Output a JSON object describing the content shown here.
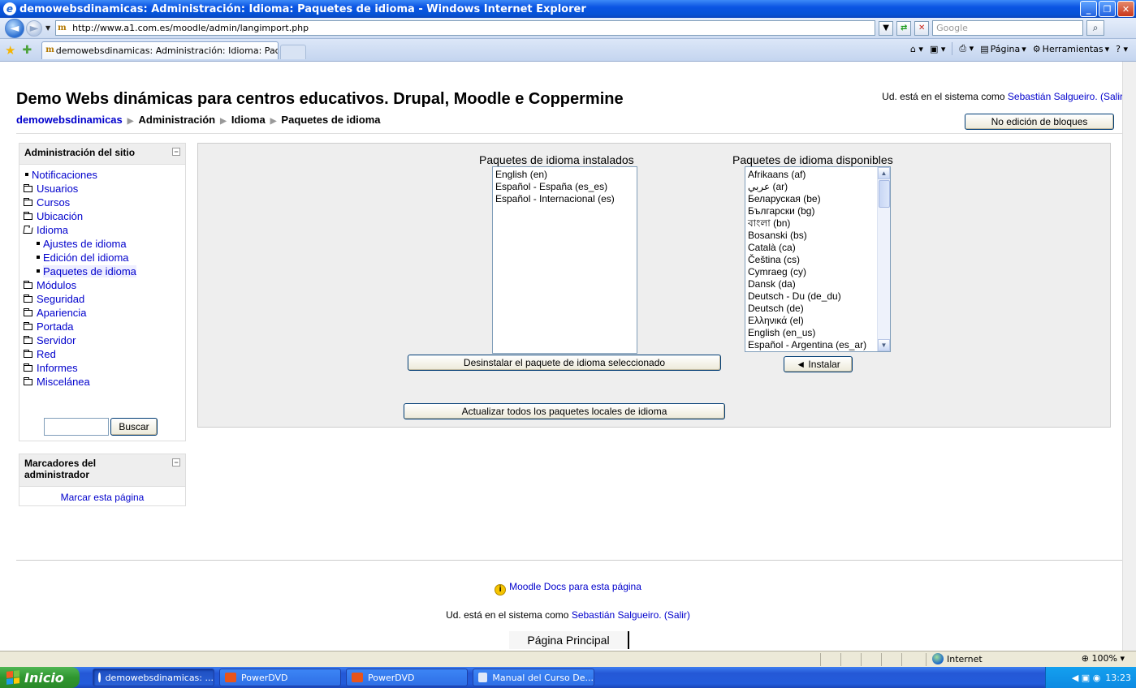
{
  "window": {
    "title": "demowebsdinamicas: Administración: Idioma: Paquetes de idioma - Windows Internet Explorer",
    "url": "http://www.a1.com.es/moodle/admin/langimport.php",
    "search_placeholder": "Google",
    "tab_title": "demowebsdinamicas: Administración: Idioma: Paquete...",
    "cmd_page": "Página",
    "cmd_tools": "Herramientas"
  },
  "header": {
    "site_title": "Demo Webs dinámicas para centros educativos. Drupal, Moodle e Coppermine",
    "login_prefix": "Ud. está en el sistema como",
    "user_name": "Sebastián Salgueiro.",
    "logout": "(Salir)",
    "edit_blocks_button": "No edición de bloques"
  },
  "breadcrumb": [
    "demowebsdinamicas",
    "Administración",
    "Idioma",
    "Paquetes de idioma"
  ],
  "admin_block": {
    "title": "Administración del sitio",
    "items": [
      {
        "label": "Notificaciones",
        "type": "leaf"
      },
      {
        "label": "Usuarios",
        "type": "folder"
      },
      {
        "label": "Cursos",
        "type": "folder"
      },
      {
        "label": "Ubicación",
        "type": "folder"
      },
      {
        "label": "Idioma",
        "type": "folder-open"
      },
      {
        "label": "Ajustes de idioma",
        "type": "sub"
      },
      {
        "label": "Edición del idioma",
        "type": "sub"
      },
      {
        "label": "Paquetes de idioma",
        "type": "sub-current"
      },
      {
        "label": "Módulos",
        "type": "folder"
      },
      {
        "label": "Seguridad",
        "type": "folder"
      },
      {
        "label": "Apariencia",
        "type": "folder"
      },
      {
        "label": "Portada",
        "type": "folder"
      },
      {
        "label": "Servidor",
        "type": "folder"
      },
      {
        "label": "Red",
        "type": "folder"
      },
      {
        "label": "Informes",
        "type": "folder"
      },
      {
        "label": "Miscelánea",
        "type": "folder"
      }
    ],
    "search_button": "Buscar"
  },
  "bookmarks_block": {
    "title": "Marcadores del administrador",
    "link": "Marcar esta página"
  },
  "main": {
    "installed_title": "Paquetes de idioma instalados",
    "installed": [
      "English (en)",
      "Español - España (es_es)",
      "Español - Internacional (es)"
    ],
    "available_title": "Paquetes de idioma disponibles",
    "available": [
      "Afrikaans (af)",
      "عربي (ar)",
      "Беларуская (be)",
      "Български (bg)",
      "বাংলা (bn)",
      "Bosanski (bs)",
      "Català (ca)",
      "Čeština (cs)",
      "Cymraeg (cy)",
      "Dansk (da)",
      "Deutsch - Du (de_du)",
      "Deutsch (de)",
      "Ελληνικά (el)",
      "English (en_us)",
      "Español - Argentina (es_ar)"
    ],
    "uninstall_button": "Desinstalar el paquete de idioma seleccionado",
    "install_button": "◄ Instalar",
    "update_all_button": "Actualizar todos los paquetes locales de idioma"
  },
  "footer": {
    "docs_link": "Moodle Docs para esta página",
    "login_prefix": "Ud. está en el sistema como",
    "user_name": "Sebastián Salgueiro.",
    "logout": "(Salir)",
    "home": "Página Principal"
  },
  "statusbar": {
    "zone": "Internet",
    "zoom": "100%"
  },
  "taskbar": {
    "start": "Inicio",
    "items": [
      "demowebsdinamicas: ...",
      "PowerDVD",
      "PowerDVD",
      "Manual del Curso De..."
    ],
    "clock": "13:23"
  }
}
